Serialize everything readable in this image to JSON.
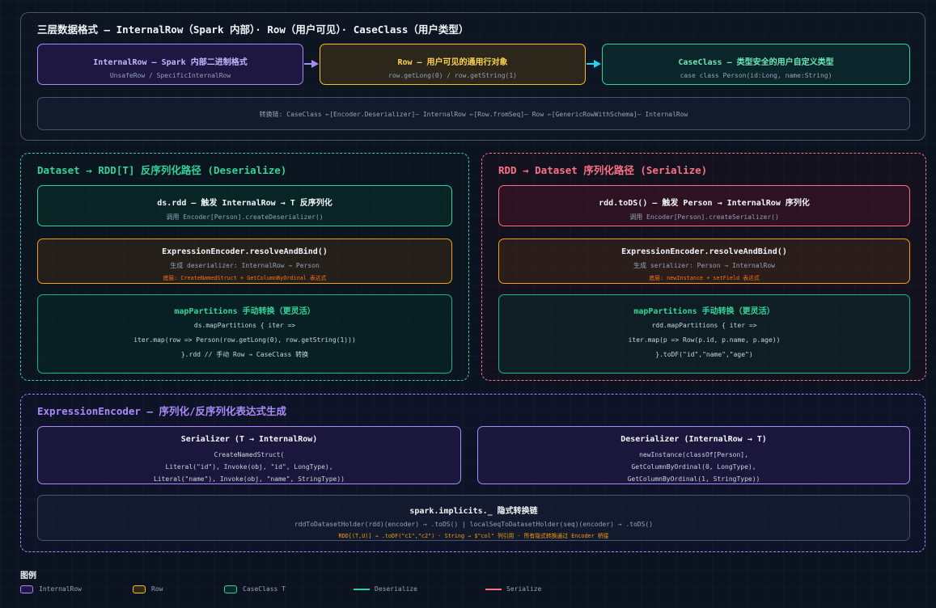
{
  "top": {
    "title": "三层数据格式 — InternalRow（Spark 内部）· Row（用户可见）· CaseClass（用户类型）",
    "internal_row": {
      "title": "InternalRow — Spark 内部二进制格式",
      "sub": "UnsafeRow / SpecificInternalRow"
    },
    "row": {
      "title": "Row — 用户可见的通用行对象",
      "sub": "row.getLong(0) / row.getString(1)"
    },
    "case_class": {
      "title": "CaseClass — 类型安全的用户自定义类型",
      "sub": "case class Person(id:Long, name:String)"
    },
    "chain": "转换链: CaseClass ←[Encoder.Deserializer]— InternalRow ←[Row.fromSeq]— Row ←[GenericRowWithSchema]— InternalRow"
  },
  "deser": {
    "title": "Dataset → RDD[T] 反序列化路径 (Deserialize)",
    "b1": {
      "title": "ds.rdd — 触发 InternalRow → T 反序列化",
      "sub": "调用 Encoder[Person].createDeserializer()"
    },
    "b2": {
      "title": "ExpressionEncoder.resolveAndBind()",
      "sub": "生成 deserializer: InternalRow → Person",
      "note": "底层: CreateNamedStruct + GetColumnByOrdinal 表达式"
    },
    "b3": {
      "title": "mapPartitions 手动转换（更灵活）",
      "l1": "ds.mapPartitions { iter =>",
      "l2": "iter.map(row => Person(row.getLong(0), row.getString(1)))",
      "l3": "}.rdd // 手动 Row → CaseClass 转换"
    }
  },
  "ser": {
    "title": "RDD → Dataset 序列化路径 (Serialize)",
    "b1": {
      "title": "rdd.toDS() — 触发 Person → InternalRow 序列化",
      "sub": "调用 Encoder[Person].createSerializer()"
    },
    "b2": {
      "title": "ExpressionEncoder.resolveAndBind()",
      "sub": "生成 serializer: Person → InternalRow",
      "note": "底层: newInstance + setField 表达式"
    },
    "b3": {
      "title": "mapPartitions 手动转换（更灵活）",
      "l1": "rdd.mapPartitions { iter =>",
      "l2": "iter.map(p => Row(p.id, p.name, p.age))",
      "l3": "}.toDF(\"id\",\"name\",\"age\")"
    }
  },
  "encoder": {
    "title": "ExpressionEncoder — 序列化/反序列化表达式生成",
    "serializer": {
      "title": "Serializer (T → InternalRow)",
      "l1": "CreateNamedStruct(",
      "l2": "Literal(\"id\"), Invoke(obj, \"id\", LongType),",
      "l3": "Literal(\"name\"), Invoke(obj, \"name\", StringType))"
    },
    "deserializer": {
      "title": "Deserializer (InternalRow → T)",
      "l1": "newInstance(classOf[Person],",
      "l2": "GetColumnByOrdinal(0, LongType),",
      "l3": "GetColumnByOrdinal(1, StringType))"
    },
    "implicits": {
      "title": "spark.implicits._ 隐式转换链",
      "sub": "rddToDatasetHolder(rdd)(encoder) → .toDS() | localSeqToDatasetHolder(seq)(encoder) → .toDS()",
      "note": "RDD[(T,U)] → .toDF(\"c1\",\"c2\") · String → $\"col\" 列引用 · 所有隐式转换通过 Encoder 桥接"
    }
  },
  "legend": {
    "title": "图例",
    "items": [
      "InternalRow",
      "Row",
      "CaseClass T",
      "Deserialize",
      "Serialize"
    ]
  },
  "colors": {
    "internal_row": "#a78bfa",
    "row": "#fbbf24",
    "case_class": "#34d399",
    "deserialize": "#34d399",
    "serialize": "#fb7185",
    "encoder_border": "#f59e0b",
    "note": "#f97316"
  }
}
